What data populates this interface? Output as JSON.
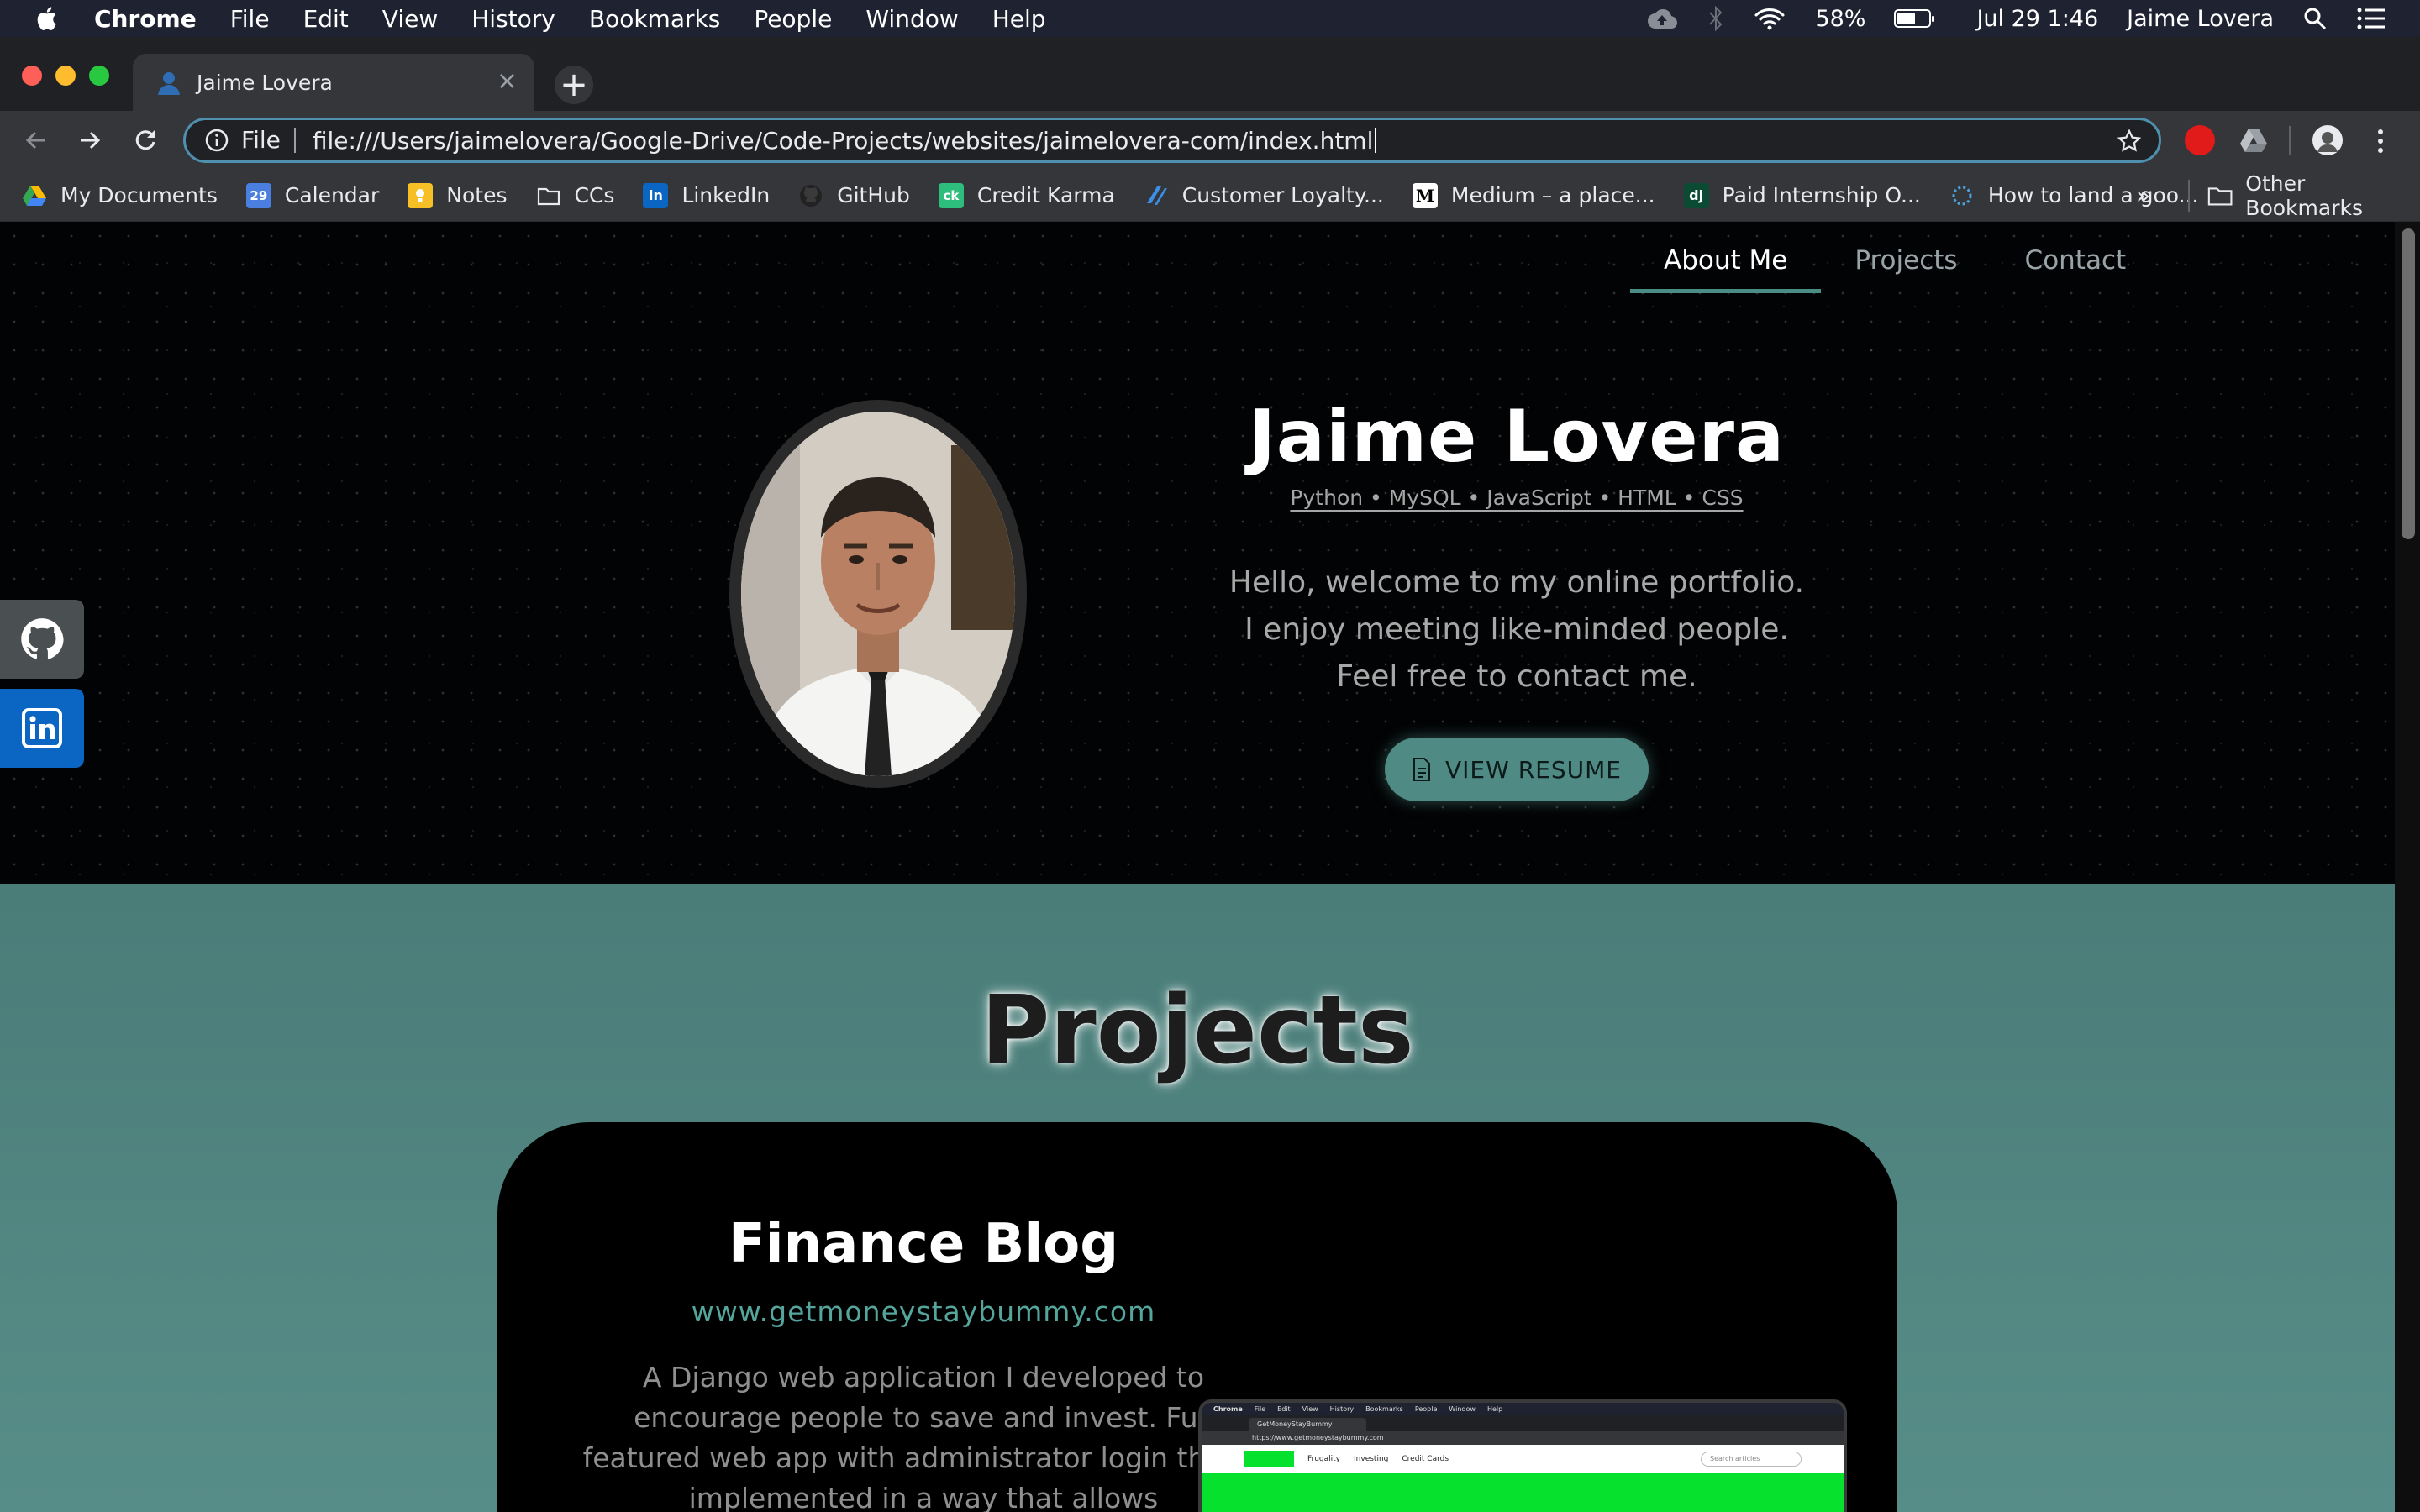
{
  "menubar": {
    "app": "Chrome",
    "items": [
      "File",
      "Edit",
      "View",
      "History",
      "Bookmarks",
      "People",
      "Window",
      "Help"
    ],
    "battery_pct": "58%",
    "battery_level": 0.58,
    "datetime": "Jul 29  1:46",
    "user": "Jaime Lovera"
  },
  "tab": {
    "title": "Jaime Lovera"
  },
  "omnibox": {
    "scheme": "File",
    "url": "file:///Users/jaimelovera/Google-Drive/Code-Projects/websites/jaimelovera-com/index.html"
  },
  "bookmarks": {
    "items": [
      {
        "label": "My Documents",
        "icon": "google-drive-icon"
      },
      {
        "label": "Calendar",
        "icon": "calendar-icon"
      },
      {
        "label": "Notes",
        "icon": "notes-icon"
      },
      {
        "label": "CCs",
        "icon": "folder-icon"
      },
      {
        "label": "LinkedIn",
        "icon": "linkedin-icon"
      },
      {
        "label": "GitHub",
        "icon": "github-icon"
      },
      {
        "label": "Credit Karma",
        "icon": "credit-karma-icon"
      },
      {
        "label": "Customer Loyalty...",
        "icon": "stripes-icon"
      },
      {
        "label": "Medium – a place...",
        "icon": "medium-icon"
      },
      {
        "label": "Paid Internship O...",
        "icon": "django-icon"
      },
      {
        "label": "How to land a goo...",
        "icon": "loading-icon"
      }
    ],
    "more": "»",
    "other": "Other Bookmarks"
  },
  "nav": {
    "about": "About Me",
    "projects": "Projects",
    "contact": "Contact"
  },
  "hero": {
    "name": "Jaime Lovera",
    "skills": "Python • MySQL • JavaScript • HTML • CSS",
    "bio": [
      "Hello, welcome to my online portfolio.",
      "I enjoy meeting like-minded people.",
      "Feel free to contact me."
    ],
    "resume_button": "VIEW RESUME"
  },
  "projects": {
    "title": "Projects",
    "card": {
      "title": "Finance Blog",
      "link": "www.getmoneystaybummy.com",
      "description": "A Django web application I developed to encourage people to save and invest. Full featured web app with administrator login that is implemented in a way that allows",
      "shot": {
        "menu": [
          "Chrome",
          "File",
          "Edit",
          "View",
          "History",
          "Bookmarks",
          "People",
          "Window",
          "Help"
        ],
        "tab": "GetMoneyStayBummy",
        "url": "https://www.getmoneystaybummy.com",
        "nav": [
          "Frugality",
          "Investing",
          "Credit Cards"
        ],
        "search": "Search articles"
      }
    }
  },
  "colors": {
    "accent": "#4f8a84",
    "link": "#54a59c",
    "linkedin": "#0a66c2"
  }
}
